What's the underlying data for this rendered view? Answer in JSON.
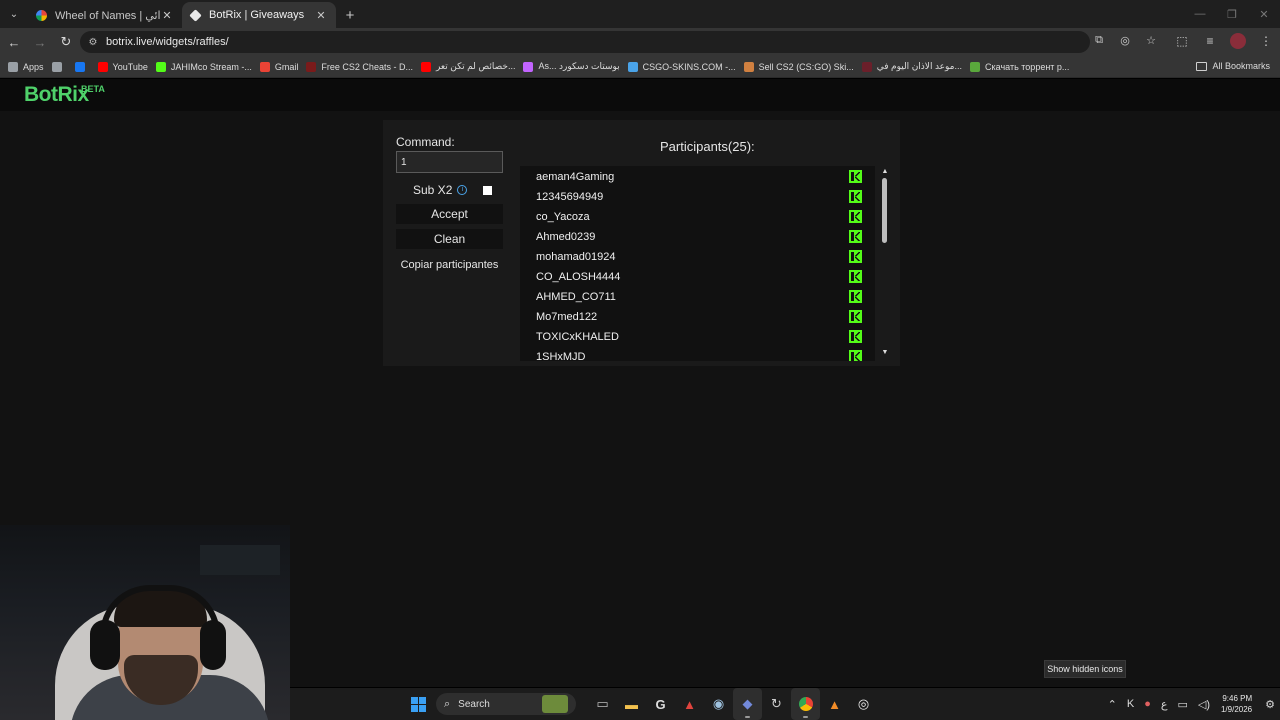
{
  "browser": {
    "tabs": [
      {
        "title": "Wheel of Names | اسم العشوائي",
        "active": false,
        "icon_color": "#e8453c"
      },
      {
        "title": "BotRix | Giveaways",
        "active": true,
        "icon_color": "#e8e8e8"
      }
    ],
    "url": "botrix.live/widgets/raffles/",
    "bookmarks": [
      {
        "label": "Apps",
        "color": "#9aa0a6"
      },
      {
        "label": "",
        "color": "#9aa0a6"
      },
      {
        "label": "",
        "color": "#1877f2"
      },
      {
        "label": "YouTube",
        "color": "#ff0000"
      },
      {
        "label": "JAHIMco Stream -...",
        "color": "#53fc18"
      },
      {
        "label": "Gmail",
        "color": "#ea4335"
      },
      {
        "label": "Free CS2 Cheats - D...",
        "color": "#7a1b1b"
      },
      {
        "label": "خصائص لم تكن تعر...",
        "color": "#ff0000"
      },
      {
        "label": "As... بوستات دسكورد",
        "color": "#c264ff"
      },
      {
        "label": "CSGO-SKINS.COM -...",
        "color": "#4aa3e8"
      },
      {
        "label": "Sell CS2 (CS:GO) Ski...",
        "color": "#d08040"
      },
      {
        "label": "موعد الاذان اليوم في...",
        "color": "#6b1f2a"
      },
      {
        "label": "Скачать торрент р...",
        "color": "#5aa83c"
      }
    ],
    "all_bookmarks": "All Bookmarks"
  },
  "site": {
    "logo": "BotRix",
    "beta": "BETA"
  },
  "raffle": {
    "command_label": "Command:",
    "command_value": "1",
    "sub_label": "Sub X2",
    "sub_checked": false,
    "accept_label": "Accept",
    "clean_label": "Clean",
    "copy_label": "Copiar participantes",
    "participants_title": "Participants(25):",
    "participants": [
      "aeman4Gaming",
      "12345694949",
      "co_Yacoza",
      "Ahmed0239",
      "mohamad01924",
      "CO_ALOSH4444",
      "AHMED_CO711",
      "Mo7med122",
      "TOXICxKHALED",
      "1SHxMJD"
    ],
    "platform_icon": "kick-icon",
    "platform_color": "#53fc18"
  },
  "tooltip": "Show hidden icons",
  "taskbar": {
    "search_placeholder": "Search",
    "time": "9:46 PM",
    "date": "1/9/2026",
    "lang": "ع"
  }
}
